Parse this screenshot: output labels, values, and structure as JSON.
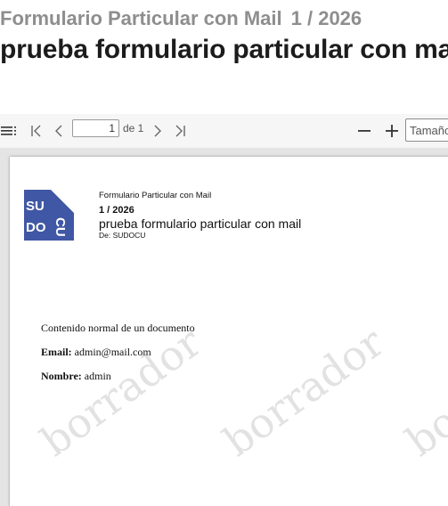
{
  "header": {
    "doc_type": "Formulario Particular con Mail",
    "doc_number": "1 / 2026",
    "doc_title": "prueba formulario particular con mail"
  },
  "toolbar": {
    "current_page": "1",
    "of_label": "de 1",
    "zoom_placeholder": "Tamaño"
  },
  "document": {
    "logo_text": [
      "SU",
      "DO",
      "CU"
    ],
    "type_line": "Formulario Particular con Mail",
    "number_line": "1 / 2026",
    "title_line": "prueba formulario particular con mail",
    "from_line": "De: SUDOCU",
    "body": {
      "intro": "Contenido normal de un documento",
      "email_label": "Email:",
      "email_value": "admin@mail.com",
      "name_label": "Nombre:",
      "name_value": "admin"
    },
    "watermark": "borrador"
  },
  "colors": {
    "logo_blue": "#3f57a4",
    "header_gray": "#8e8e8e",
    "viewer_bg": "#e4e4e4"
  }
}
